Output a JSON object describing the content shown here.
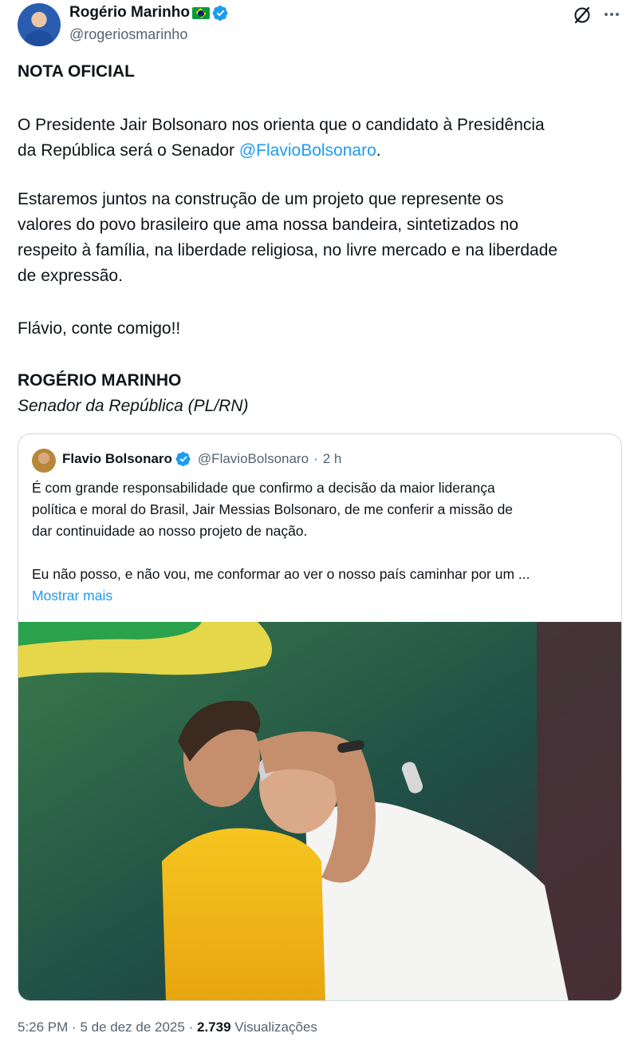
{
  "author": {
    "name": "Rogério Marinho",
    "handle": "@rogeriosmarinho",
    "flag_icon": "brazil-flag-icon",
    "verified_icon": "verified-badge-icon"
  },
  "header_actions": {
    "grok_icon": "grok-icon",
    "more_icon": "more-icon"
  },
  "post": {
    "heading": "NOTA OFICIAL",
    "p1_line1": "O Presidente Jair Bolsonaro nos orienta que o candidato à Presidência",
    "p1_line2_start": "da República será o Senador ",
    "p1_mention": "@FlavioBolsonaro",
    "p1_line2_end": ".",
    "p2_line1": "Estaremos juntos na construção de um projeto que represente os",
    "p2_line2": "valores do povo brasileiro que ama nossa bandeira, sintetizados no",
    "p2_line3": "respeito à família, na liberdade religiosa, no livre mercado e na liberdade",
    "p2_line4": "de expressão.",
    "p3": "Flávio, conte comigo!!",
    "signature_name": "ROGÉRIO MARINHO",
    "signature_title": "Senador da República (PL/RN)"
  },
  "quote": {
    "name": "Flavio Bolsonaro",
    "handle": "@FlavioBolsonaro",
    "separator": "·",
    "time": "2 h",
    "line1": "É com grande responsabilidade que confirmo a decisão da maior liderança",
    "line2": "política e moral do Brasil, Jair Messias Bolsonaro, de me conferir a missão de",
    "line3": "dar continuidade ao nosso projeto de nação.",
    "line4": "Eu não posso, e não vou, me conformar ao ver o nosso país caminhar por um ...",
    "show_more": "Mostrar mais"
  },
  "footer": {
    "time": "5:26 PM",
    "sep1": "·",
    "date": "5 de dez de 2025",
    "sep2": "·",
    "views_count": "2.739",
    "views_label": "Visualizações"
  },
  "colors": {
    "link": "#1d9bf0",
    "secondary_text": "#536471",
    "border": "#cfd9de"
  }
}
